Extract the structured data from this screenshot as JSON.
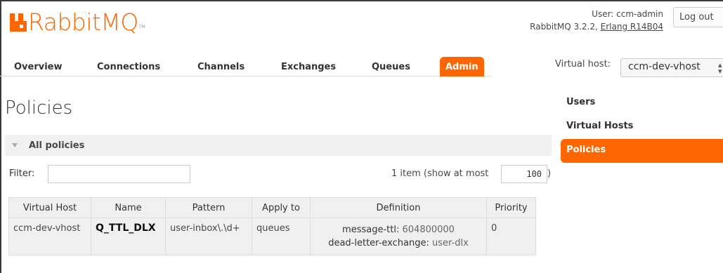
{
  "brand": {
    "name": "RabbitMQ",
    "tm": "TM",
    "accent": "#ff6600"
  },
  "user": {
    "label": "User:",
    "name": "ccm-admin",
    "version": "RabbitMQ 3.2.2,",
    "erlang": "Erlang R14B04",
    "logout_label": "Log out"
  },
  "nav": {
    "tabs": [
      {
        "label": "Overview"
      },
      {
        "label": "Connections"
      },
      {
        "label": "Channels"
      },
      {
        "label": "Exchanges"
      },
      {
        "label": "Queues"
      },
      {
        "label": "Admin",
        "active": true
      }
    ],
    "vhost_label": "Virtual host:",
    "vhost_value": "ccm-dev-vhost"
  },
  "page": {
    "title": "Policies",
    "section_title": "All policies",
    "filter_label": "Filter:",
    "filter_value": "",
    "count_text": "1 item (show at most",
    "max_value": "100",
    "paren_close": ")"
  },
  "table": {
    "headers": [
      "Virtual Host",
      "Name",
      "Pattern",
      "Apply to",
      "Definition",
      "Priority"
    ],
    "rows": [
      {
        "vhost": "ccm-dev-vhost",
        "name": "Q_TTL_DLX",
        "pattern": "user-inbox\\.\\d+",
        "apply_to": "queues",
        "def_key_1": "message-ttl:",
        "def_val_1": "604800000",
        "def_key_2": "dead-letter-exchange:",
        "def_val_2": "user-dlx",
        "priority": "0"
      }
    ]
  },
  "side_menu": {
    "items": [
      {
        "label": "Users"
      },
      {
        "label": "Virtual Hosts"
      },
      {
        "label": "Policies",
        "active": true
      }
    ]
  }
}
